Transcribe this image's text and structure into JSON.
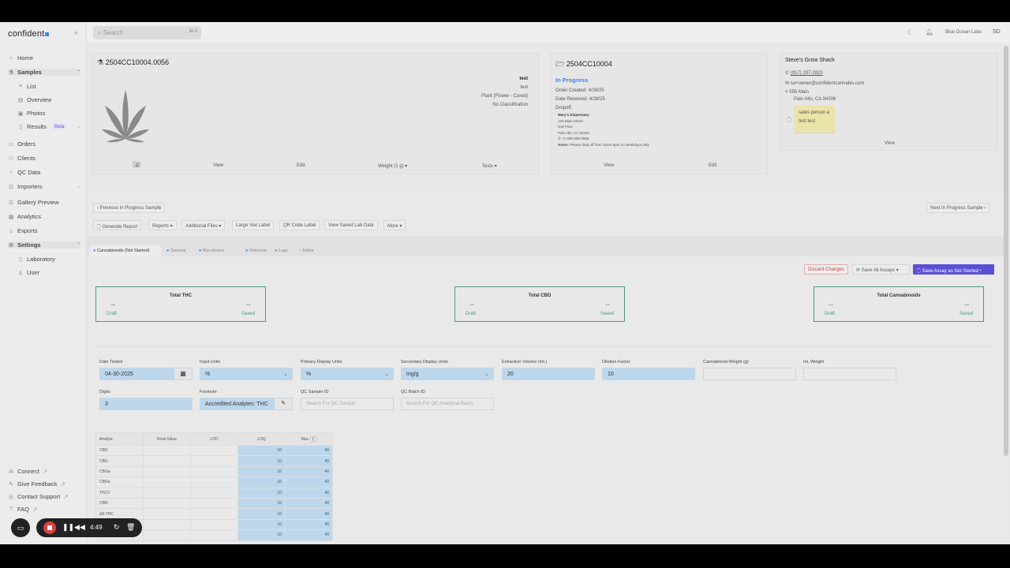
{
  "app": {
    "logo": "confident",
    "search_placeholder": "Search",
    "search_shortcut": "⌘ K",
    "org": "Blue Ocean Labs",
    "user_initials": "SD"
  },
  "sidebar": {
    "items": [
      {
        "label": "Home",
        "icon": "home-icon"
      },
      {
        "label": "Samples",
        "icon": "flask-icon",
        "expanded": true
      },
      {
        "label": "List",
        "icon": "list-icon",
        "sub": true
      },
      {
        "label": "Overview",
        "icon": "clipboard-icon",
        "sub": true
      },
      {
        "label": "Photos",
        "icon": "image-icon",
        "sub": true
      },
      {
        "label": "Results",
        "icon": "results-icon",
        "sub": true,
        "badge": "Beta"
      },
      {
        "label": "Orders",
        "icon": "folder-icon"
      },
      {
        "label": "Clients",
        "icon": "users-icon"
      },
      {
        "label": "QC Data",
        "icon": "microscope-icon"
      },
      {
        "label": "Importers",
        "icon": "import-icon"
      },
      {
        "label": "Gallery Preview",
        "icon": "gallery-icon"
      },
      {
        "label": "Analytics",
        "icon": "chart-icon"
      },
      {
        "label": "Exports",
        "icon": "download-icon"
      },
      {
        "label": "Settings",
        "icon": "gear-icon",
        "expanded": true
      },
      {
        "label": "Laboratory",
        "icon": "building-icon",
        "sub": true
      },
      {
        "label": "User",
        "icon": "user-icon",
        "sub": true
      }
    ],
    "footer": [
      {
        "label": "Connect"
      },
      {
        "label": "Give Feedback"
      },
      {
        "label": "Contact Support"
      },
      {
        "label": "FAQ"
      }
    ]
  },
  "sample_card": {
    "id": "2504CC10004.0056",
    "name": "test",
    "desc": "test",
    "type": "Plant (Flower - Cured)",
    "classification": "No Classification",
    "actions": [
      "View",
      "Edit",
      "Weight (1 g) ▾",
      "Tests ▾"
    ]
  },
  "order_card": {
    "id": "2504CC10004",
    "status": "In Progress",
    "created": "Order Created: 4/28/25",
    "received": "Date Received: 4/28/25",
    "dropoff_label": "Dropoff:",
    "dropoff_name": "Mary's Dispensary",
    "addr1": "123 Main Street",
    "addr2": "2nd Floor",
    "addr3": "Palo Alto, CA 94301",
    "phone": "+1 555-555-5555",
    "notes_label": "Notes:",
    "notes": "Please drop off from 10am-6pm on weekdays only.",
    "actions": [
      "View",
      "Edit"
    ]
  },
  "client_card": {
    "name": "Steve's Grow Shack",
    "phone": "(917) 297-2820",
    "email": "sa+owner@confidentcannabis.com",
    "addr1": "555 Main",
    "addr2": "Palo Alto, CA 94306",
    "note1": "sales person a",
    "note2": "test test",
    "view": "View"
  },
  "nav": {
    "prev": "Previous In Progress Sample",
    "next": "Next In Progress Sample"
  },
  "toolbar": [
    "Generate Report",
    "Reports ▾",
    "Additional Files ▾",
    "Large Vial Label",
    "QR Code Label",
    "View Saved Lab Data",
    "More ▾"
  ],
  "tabs": [
    "Cannabinoids (Not Started)",
    "General",
    "Mycotoxins",
    "Nutrients",
    "Logs",
    "Editor"
  ],
  "assay_actions": {
    "discard": "Discard Changes",
    "save_all": "Save All Assays",
    "save_assay": "Save Assay as Not Started"
  },
  "totals": [
    {
      "title": "Total THC",
      "draft": "—",
      "saved": "—"
    },
    {
      "title": "Total CBD",
      "draft": "—",
      "saved": "—"
    },
    {
      "title": "Total Cannabinoids",
      "draft": "—",
      "saved": "—"
    }
  ],
  "totals_labels": {
    "draft": "Draft",
    "saved": "Saved"
  },
  "form": {
    "date_tested": {
      "label": "Date Tested",
      "value": "04-30-2025"
    },
    "input_units": {
      "label": "Input Units",
      "value": "%"
    },
    "primary_units": {
      "label": "Primary Display Units",
      "value": "%"
    },
    "secondary_units": {
      "label": "Secondary Display Units",
      "value": "mg/g"
    },
    "extraction_volume": {
      "label": "Extraction Volume (mL)",
      "value": "20"
    },
    "dilution_factor": {
      "label": "Dilution Factor",
      "value": "10"
    },
    "cannabinoid_weight": {
      "label": "Cannabinoid Weight (g)",
      "value": ""
    },
    "ml_weight": {
      "label": "mL Weight",
      "value": ""
    },
    "digits": {
      "label": "Digits",
      "value": "3"
    },
    "footnote": {
      "label": "Footnote",
      "value": "Accredited Analytes: THC"
    },
    "qc_sample": {
      "label": "QC Sample ID",
      "placeholder": "Search For QC Sample"
    },
    "qc_batch": {
      "label": "QC Batch ID",
      "placeholder": "Search For QC Analytical Batch"
    }
  },
  "table": {
    "headers": [
      "Analyte",
      "Final Value",
      "LOD",
      "LOQ",
      "Max"
    ],
    "rows": [
      [
        "CBD",
        "",
        "",
        "10",
        "40"
      ],
      [
        "CBG",
        "",
        "",
        "10",
        "40"
      ],
      [
        "CBGa",
        "",
        "",
        "10",
        "40"
      ],
      [
        "CBDa",
        "",
        "",
        "10",
        "40"
      ],
      [
        "THCV",
        "",
        "",
        "10",
        "40"
      ],
      [
        "CBN",
        "",
        "",
        "10",
        "40"
      ],
      [
        "Δ9-THC",
        "",
        "",
        "10",
        "40"
      ],
      [
        "",
        "",
        "",
        "10",
        "40"
      ],
      [
        "",
        "",
        "",
        "10",
        "40"
      ]
    ]
  },
  "recorder": {
    "time": "4:49"
  },
  "colors": {
    "accent": "#5b4fd6",
    "status_blue": "#3b82f6",
    "green": "#4a9a7a",
    "field_blue": "#bcd7ec",
    "discard": "#d04848"
  }
}
